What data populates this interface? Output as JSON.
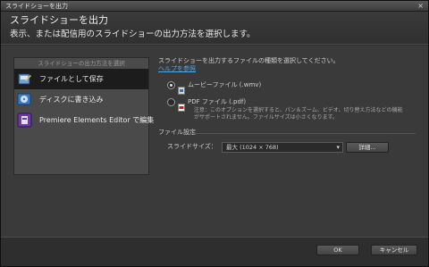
{
  "window": {
    "title": "スライドショーを出力",
    "close_glyph": "×"
  },
  "header": {
    "heading": "スライドショーを出力",
    "subheading": "表示、または配信用のスライドショーの出力方法を選択します。"
  },
  "left_panel": {
    "title": "スライドショーの出力方法を選択",
    "items": [
      {
        "label": "ファイルとして保存",
        "icon": "save-file-icon",
        "active": true
      },
      {
        "label": "ディスクに書き込み",
        "icon": "burn-disc-icon",
        "active": false
      },
      {
        "label": "Premiere Elements Editor で編集",
        "icon": "premiere-elements-icon",
        "active": false
      }
    ]
  },
  "right_panel": {
    "instruction": "スライドショーを出力するファイルの種類を選択してください。",
    "help_link": "ヘルプを参照",
    "options": [
      {
        "label": "ムービーファイル (.wmv)",
        "icon": "movie-file-icon",
        "selected": true
      },
      {
        "label": "PDF ファイル (.pdf)",
        "icon": "pdf-file-icon",
        "selected": false
      }
    ],
    "pdf_note_line1": "注意：このオプションを選択すると、パン＆ズーム、ビデオ、切り替え方法などの機能",
    "pdf_note_line2": "がサポートされません。ファイルサイズは小さくなります。",
    "file_settings_label": "ファイル設定",
    "slide_size_label": "スライドサイズ：",
    "slide_size_value": "最大 (1024 × 768)",
    "details_button": "詳細..."
  },
  "footer": {
    "ok": "OK",
    "cancel": "キャンセル"
  },
  "colors": {
    "link": "#4fa8e8",
    "active_nav": "#1c1c1c",
    "panel": "#4a4a4a"
  }
}
